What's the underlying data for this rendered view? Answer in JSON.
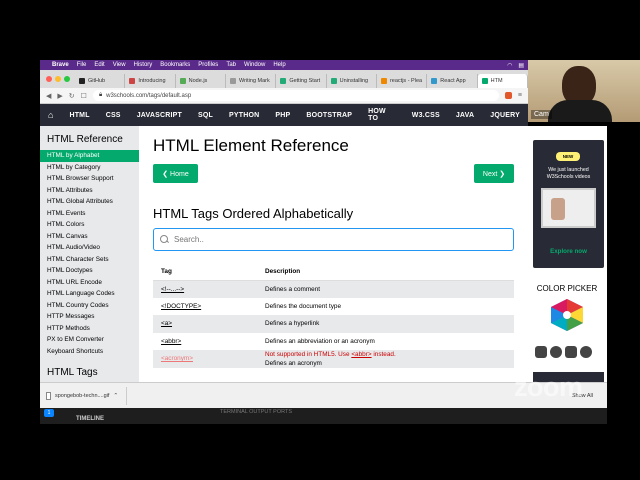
{
  "menubar": {
    "app": "Brave",
    "items": [
      "File",
      "Edit",
      "View",
      "History",
      "Bookmarks",
      "Profiles",
      "Tab",
      "Window",
      "Help"
    ]
  },
  "tabs": [
    "GitHub",
    "Introducing",
    "Node.js",
    "Writing Mark",
    "Getting Start",
    "Uninstalling",
    "reactjs - Plea",
    "React App",
    "HTM"
  ],
  "address": {
    "url": "w3schools.com/tags/default.asp"
  },
  "w3nav": [
    "HTML",
    "CSS",
    "JAVASCRIPT",
    "SQL",
    "PYTHON",
    "PHP",
    "BOOTSTRAP",
    "HOW TO",
    "W3.CSS",
    "JAVA",
    "JQUERY"
  ],
  "sidebar": {
    "heading": "HTML Reference",
    "items": [
      "HTML by Alphabet",
      "HTML by Category",
      "HTML Browser Support",
      "HTML Attributes",
      "HTML Global Attributes",
      "HTML Events",
      "HTML Colors",
      "HTML Canvas",
      "HTML Audio/Video",
      "HTML Character Sets",
      "HTML Doctypes",
      "HTML URL Encode",
      "HTML Language Codes",
      "HTML Country Codes",
      "HTTP Messages",
      "HTTP Methods",
      "PX to EM Converter",
      "Keyboard Shortcuts"
    ],
    "heading2": "HTML Tags"
  },
  "main": {
    "title": "HTML Element Reference",
    "home_label": "❮ Home",
    "next_label": "Next ❯",
    "subtitle": "HTML Tags Ordered Alphabetically",
    "search_placeholder": "Search..",
    "table": {
      "headers": [
        "Tag",
        "Description"
      ],
      "rows": [
        {
          "tag": "<!--...-->",
          "desc": "Defines a comment"
        },
        {
          "tag": "<!DOCTYPE>",
          "desc": "Defines the document type"
        },
        {
          "tag": "<a>",
          "desc": "Defines a hyperlink"
        },
        {
          "tag": "<abbr>",
          "desc": "Defines an abbreviation or an acronym"
        },
        {
          "tag": "<acronym>",
          "desc_pre": "Not supported in HTML5. Use ",
          "desc_link": "<abbr>",
          "desc_post": " instead.",
          "desc2": "Defines an acronym"
        }
      ]
    }
  },
  "right": {
    "ad_badge": "NEW",
    "ad_text1": "We just launched",
    "ad_text2": "W3Schools videos",
    "ad_cta": "Explore now",
    "color_picker": "COLOR PICKER"
  },
  "downloads": {
    "file": "spongebob-techn....gif",
    "show_all": "Show All"
  },
  "vscode": {
    "badge": "1",
    "timeline": "TIMELINE",
    "status": "TERMINAL  OUTPUT  PORTS"
  },
  "zoom": "zoom",
  "webcam": {
    "name": "Cam"
  },
  "colors": {
    "w3green": "#04aa6d",
    "w3dark": "#282a35",
    "sidebar": "#e7e9eb",
    "menubar": "#5a2a8a"
  }
}
